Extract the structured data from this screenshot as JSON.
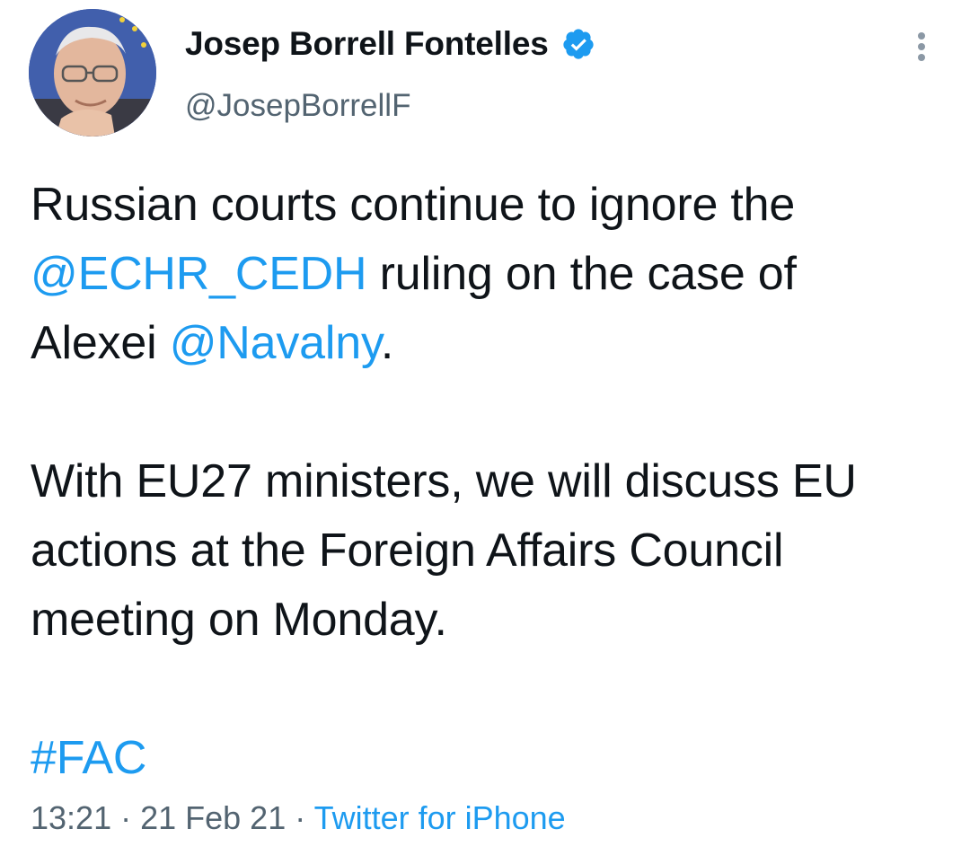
{
  "author": {
    "display_name": "Josep Borrell Fontelles",
    "handle": "@JosepBorrellF",
    "verified": true,
    "avatar_icon": "profile-photo"
  },
  "tweet": {
    "line1_text": "Russian courts continue to ignore the",
    "mention_echr": "@ECHR_CEDH",
    "line2_text": " ruling on the case of",
    "line3_prefix": "Alexei ",
    "mention_navalny": "@Navalny",
    "line3_suffix": ".",
    "paragraph2": "With EU27 ministers, we will discuss EU actions at the Foreign Affairs Council meeting on Monday.",
    "hashtag": "#FAC"
  },
  "meta": {
    "time": "13:21",
    "separator": " · ",
    "date": "21 Feb 21",
    "source": "Twitter for iPhone"
  },
  "colors": {
    "link": "#1d9bf0",
    "secondary_text": "#536471",
    "primary_text": "#0f1419",
    "verified_badge": "#1d9bf0"
  },
  "icons": {
    "verified": "verified-badge-icon",
    "more": "more-options-icon"
  }
}
